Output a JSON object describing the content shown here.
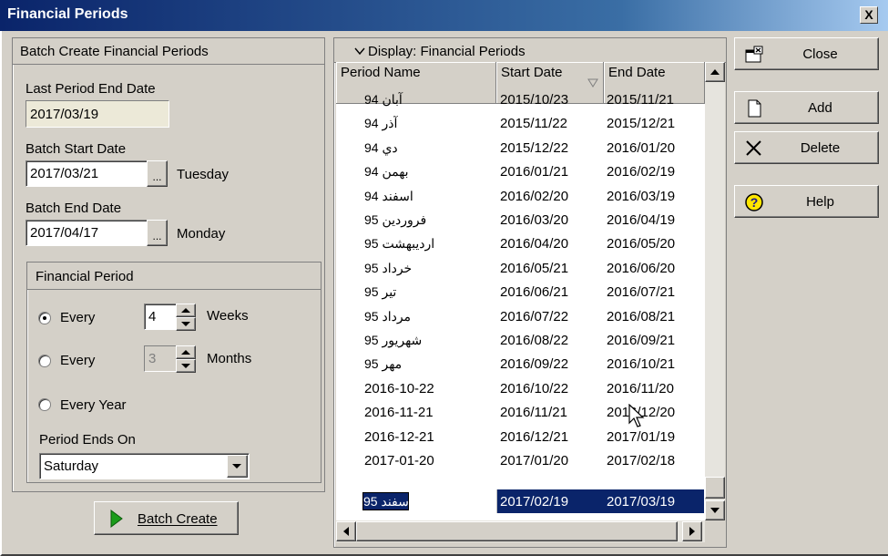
{
  "window": {
    "title": "Financial Periods",
    "close_glyph": "X"
  },
  "batch": {
    "header": "Batch Create Financial Periods",
    "last_end_label": "Last Period End Date",
    "last_end_value": "2017/03/19",
    "start_label": "Batch Start Date",
    "start_value": "2017/03/21",
    "start_day": "Tuesday",
    "end_label": "Batch End Date",
    "end_value": "2017/04/17",
    "end_day": "Monday",
    "ellipsis": "...",
    "period_group": "Financial Period",
    "every_weeks_label": "Every",
    "weeks_value": "4",
    "weeks_unit": "Weeks",
    "every_months_label": "Every",
    "months_value": "3",
    "months_unit": "Months",
    "every_year_label": "Every Year",
    "period_ends_label": "Period Ends On",
    "period_ends_value": "Saturday",
    "create_button": "Batch Create"
  },
  "display": {
    "header": "Display: Financial Periods",
    "columns": [
      "Period Name",
      "Start Date",
      "End Date"
    ],
    "rows": [
      [
        "آبان 94",
        "2015/10/23",
        "2015/11/21"
      ],
      [
        "آذر 94",
        "2015/11/22",
        "2015/12/21"
      ],
      [
        "دي 94",
        "2015/12/22",
        "2016/01/20"
      ],
      [
        "بهمن 94",
        "2016/01/21",
        "2016/02/19"
      ],
      [
        "اسفند 94",
        "2016/02/20",
        "2016/03/19"
      ],
      [
        "فروردین 95",
        "2016/03/20",
        "2016/04/19"
      ],
      [
        "اردیبهشت 95",
        "2016/04/20",
        "2016/05/20"
      ],
      [
        "خرداد 95",
        "2016/05/21",
        "2016/06/20"
      ],
      [
        "تیر 95",
        "2016/06/21",
        "2016/07/21"
      ],
      [
        "مرداد 95",
        "2016/07/22",
        "2016/08/21"
      ],
      [
        "شهریور 95",
        "2016/08/22",
        "2016/09/21"
      ],
      [
        "مهر 95",
        "2016/09/22",
        "2016/10/21"
      ],
      [
        "2016-10-22",
        "2016/10/22",
        "2016/11/20"
      ],
      [
        "2016-11-21",
        "2016/11/21",
        "2016/12/20"
      ],
      [
        "2016-12-21",
        "2016/12/21",
        "2017/01/19"
      ],
      [
        "2017-01-20",
        "2017/01/20",
        "2017/02/18"
      ]
    ],
    "selected_row": [
      "95 اسفند",
      "2017/02/19",
      "2017/03/19"
    ]
  },
  "actions": {
    "close": "Close",
    "add": "Add",
    "delete": "Delete",
    "help": "Help"
  }
}
